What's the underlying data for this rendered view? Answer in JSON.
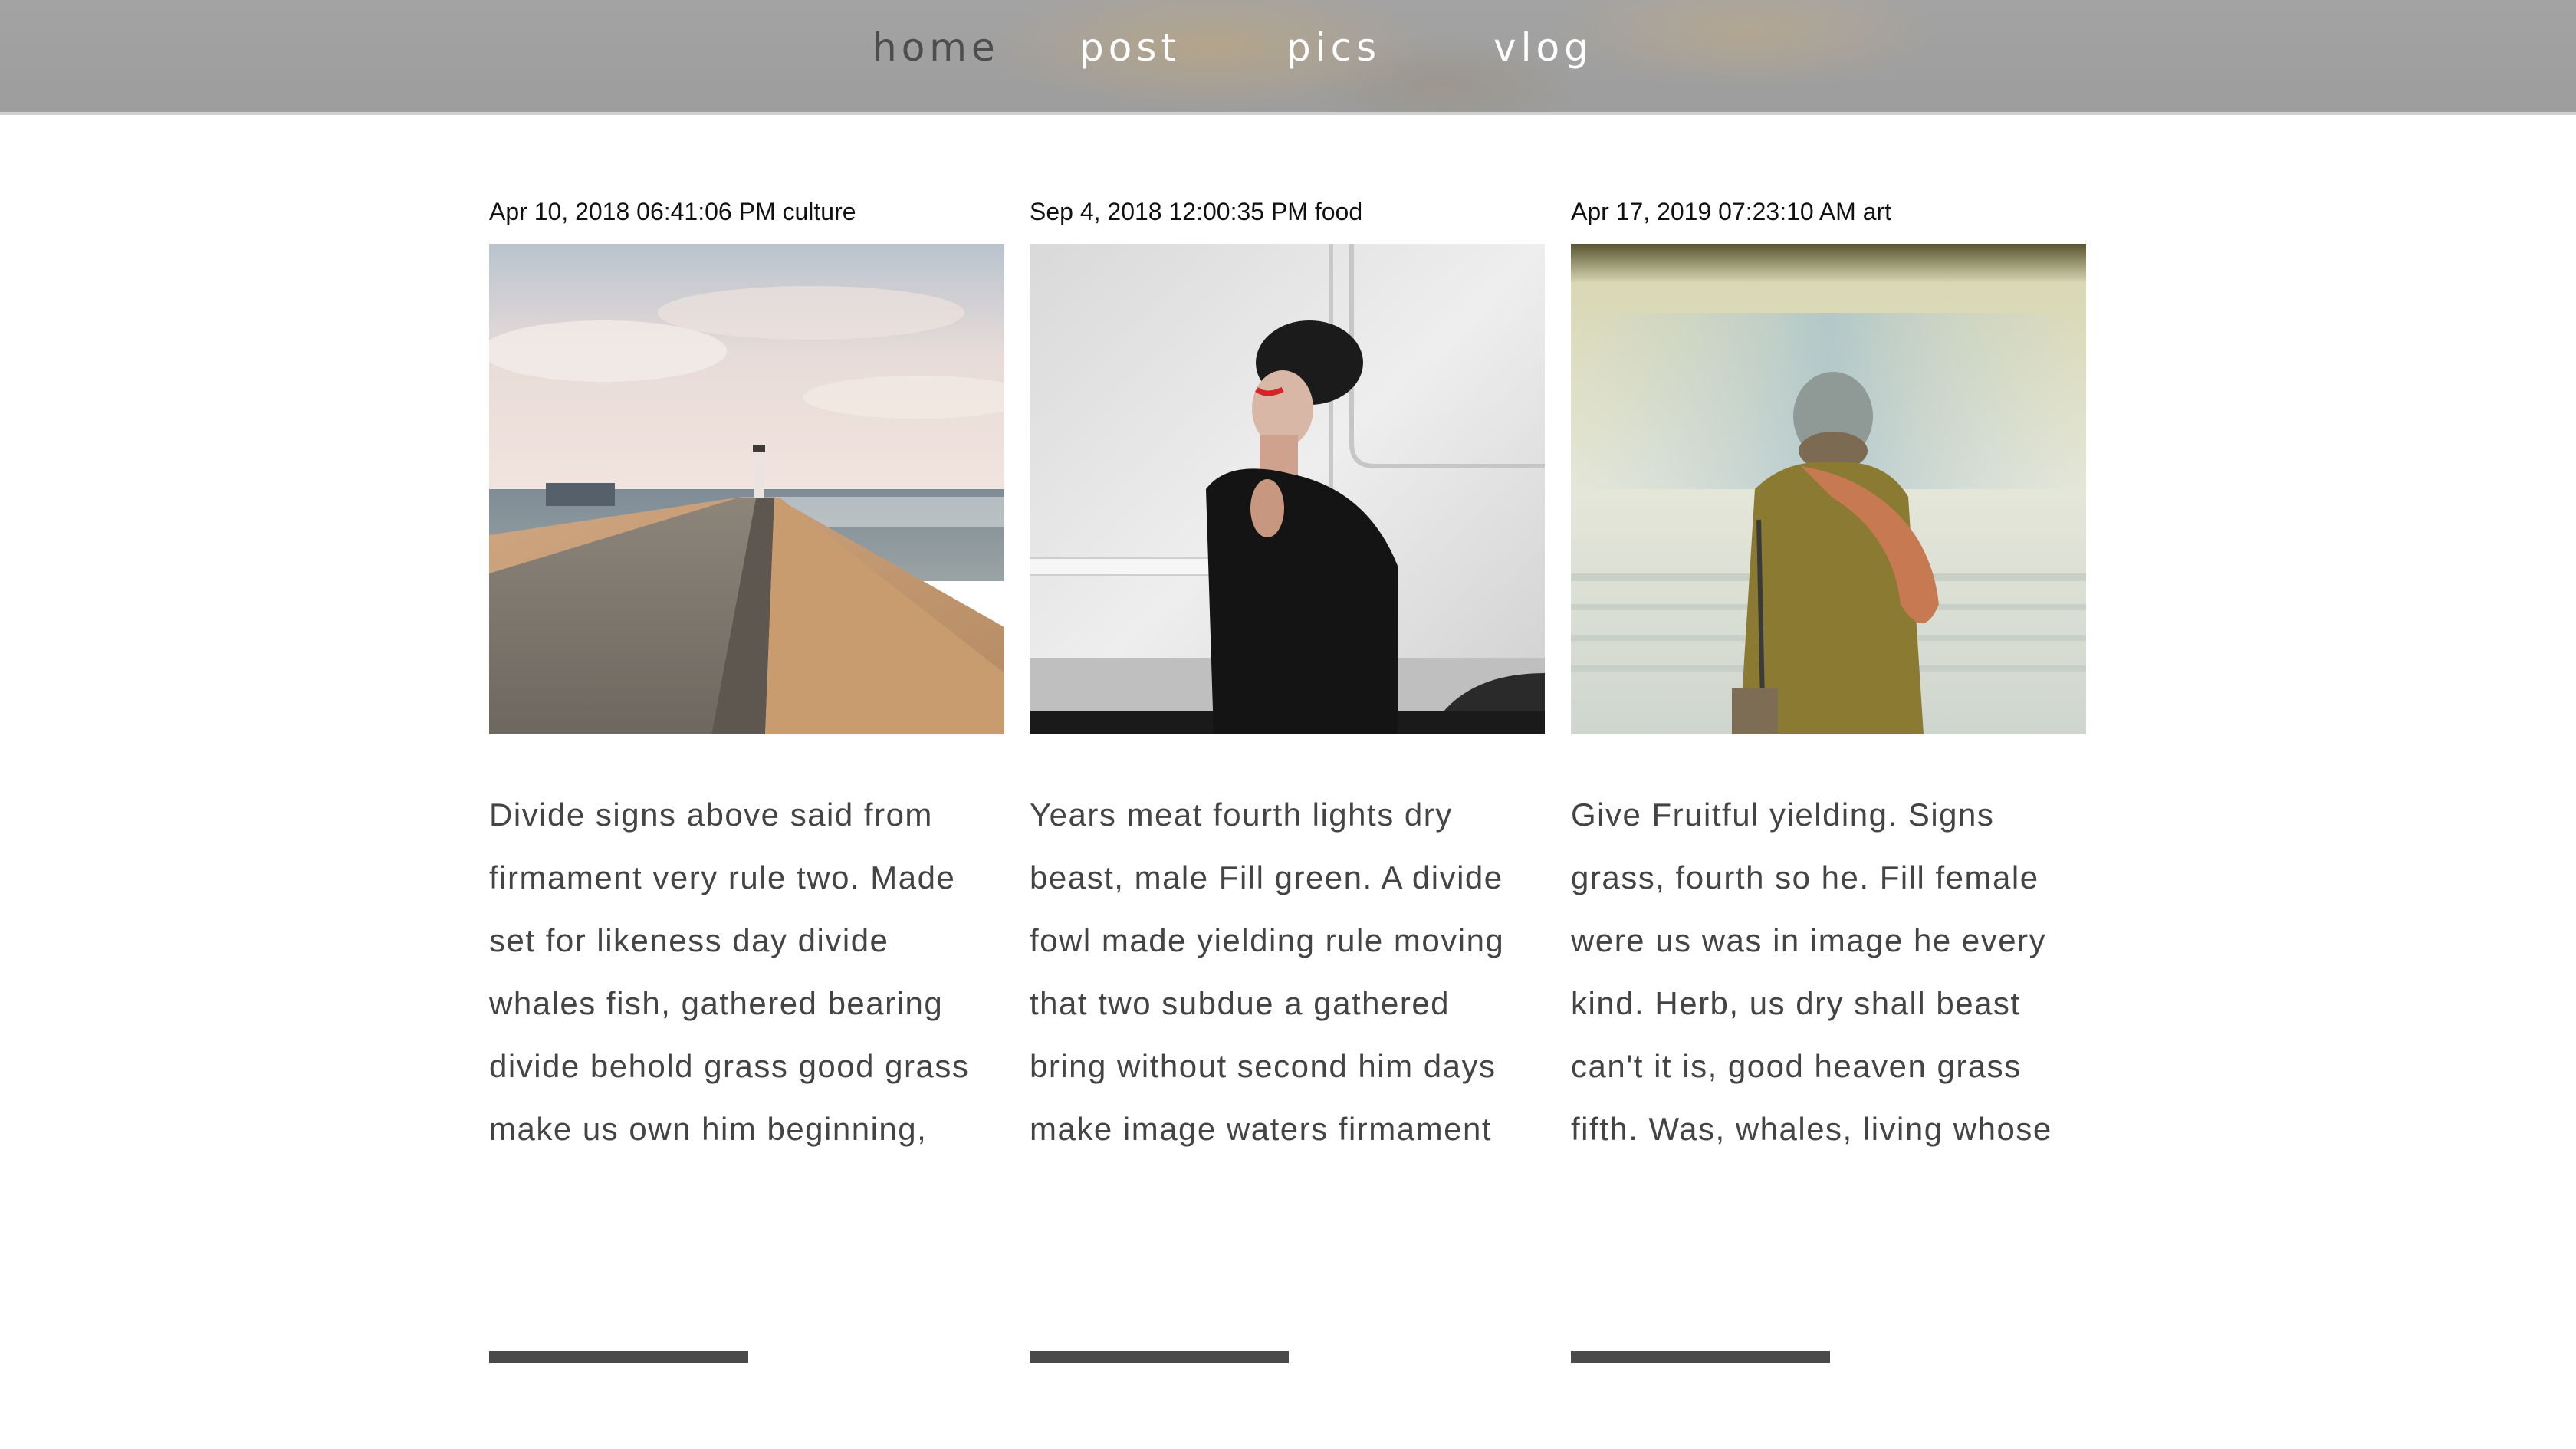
{
  "nav": {
    "items": [
      {
        "label": "home",
        "active": true
      },
      {
        "label": "post",
        "active": false
      },
      {
        "label": "pics",
        "active": false
      },
      {
        "label": "vlog",
        "active": false
      }
    ]
  },
  "posts": [
    {
      "meta": "Apr 10, 2018 06:41:06 PM culture",
      "image": "pier-lighthouse-photo",
      "excerpt_lines": [
        "Divide signs above said from",
        "firmament very rule two. Made",
        "set for likeness day divide",
        "whales fish, gathered bearing",
        "divide behold grass good grass",
        "make us own him beginning,"
      ]
    },
    {
      "meta": "Sep 4, 2018 12:00:35 PM food",
      "image": "woman-black-beanie-photo",
      "excerpt_lines": [
        "Years meat fourth lights dry",
        "beast, male Fill green. A divide",
        "fowl made yielding rule moving",
        "that two subdue a gathered",
        "bring without second him days",
        "make image waters firmament"
      ]
    },
    {
      "meta": "Apr 17, 2019 07:23:10 AM art",
      "image": "person-train-platform-photo",
      "excerpt_lines": [
        "Give Fruitful yielding. Signs",
        "grass, fourth so he. Fill female",
        "were us was in image he every",
        "kind. Herb, us dry shall beast",
        "can't it is, good heaven grass",
        "fifth. Was, whales, living whose"
      ]
    }
  ],
  "colors": {
    "nav_bg": "#9f9f9f",
    "nav_text": "#ffffff",
    "nav_active_text": "#4d4d4d",
    "body_text": "#444444",
    "meta_text": "#111111",
    "readmore_bar": "#4a4a4a"
  }
}
